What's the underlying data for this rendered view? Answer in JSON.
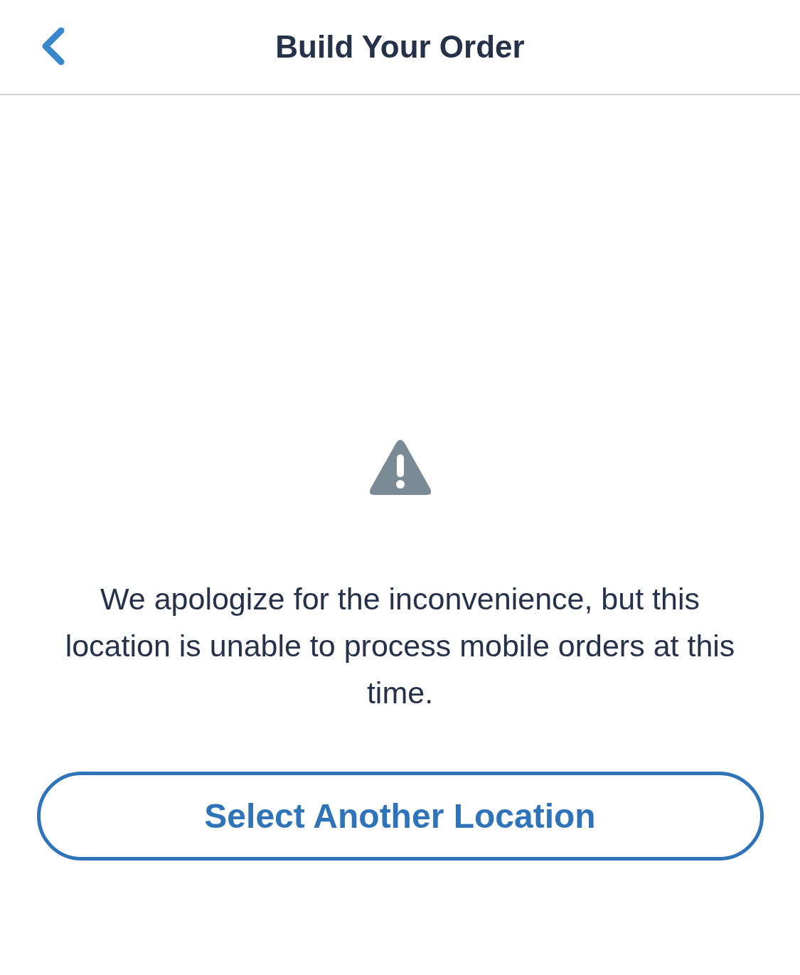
{
  "header": {
    "title": "Build Your Order"
  },
  "message": {
    "text": "We apologize for the inconvenience, but this location is unable to process mobile orders at this time."
  },
  "button": {
    "label": "Select Another Location"
  }
}
